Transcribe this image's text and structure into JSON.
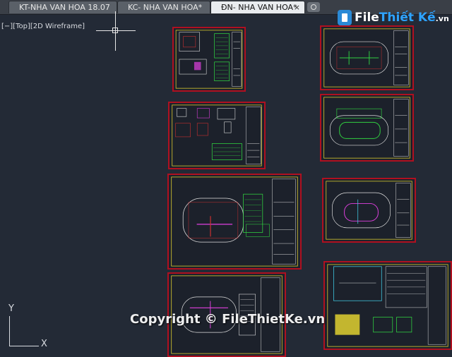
{
  "tabs": [
    {
      "label": "KT-NHA VAN HOA 18.07",
      "active": false
    },
    {
      "label": "KC- NHA VAN HOA*",
      "active": false
    },
    {
      "label": "ĐN- NHA VAN HOA*",
      "active": true
    }
  ],
  "tab_close_symbol": "×",
  "logo": {
    "part1": "File",
    "part2": "Thiết Kế",
    "part3": ".vn"
  },
  "viewport": {
    "label": "[−][Top][2D Wireframe]"
  },
  "ucs": {
    "x_label": "X",
    "y_label": "Y"
  },
  "watermark": "Copyright © FileThietKe.vn",
  "colors": {
    "background": "#232a36",
    "sheet_border": "#b01020",
    "frame_yellow": "#e0d030",
    "line_green": "#30d040",
    "line_magenta": "#e040e0",
    "line_white": "#e0e0e0",
    "line_red": "#d03030",
    "line_cyan": "#40c8e0"
  }
}
